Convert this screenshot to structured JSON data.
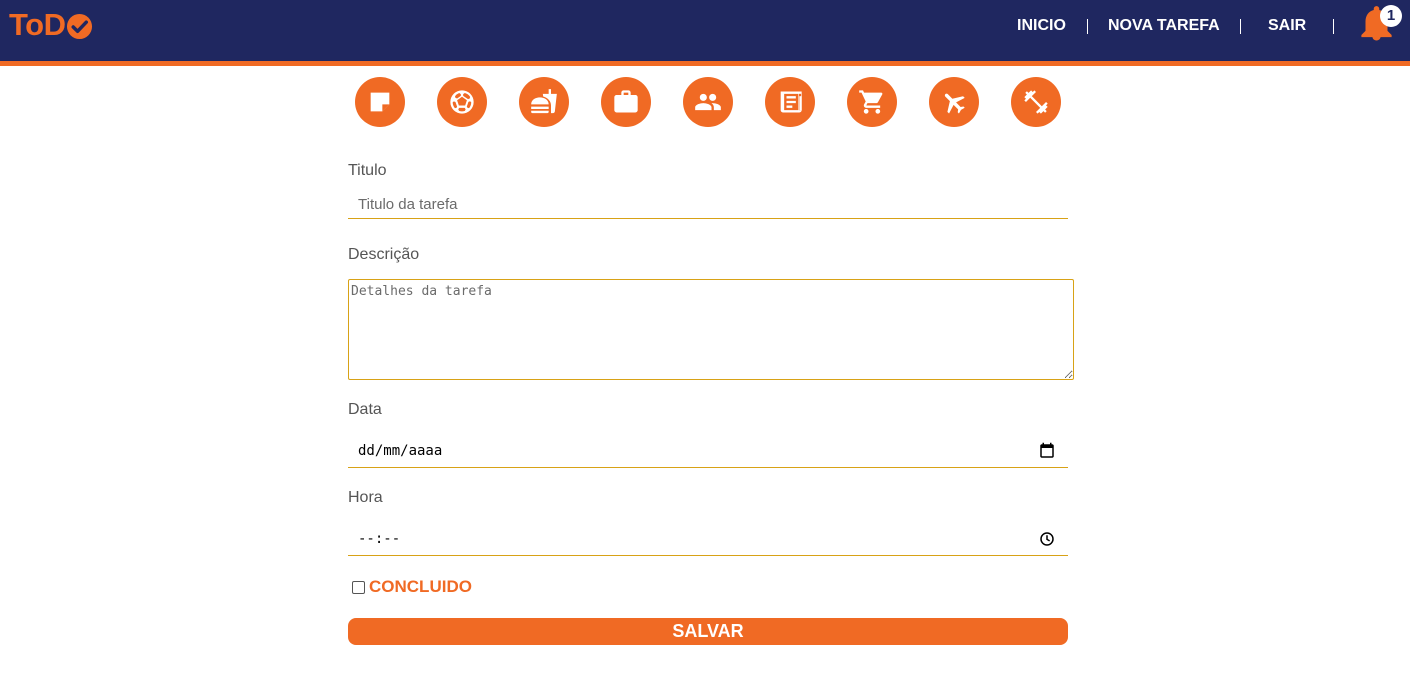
{
  "brand": {
    "logo_text": "ToD",
    "primary_color": "#1f2760",
    "accent_color": "#f06a24",
    "field_line_color": "#d8a216"
  },
  "nav": {
    "items": [
      {
        "label": "INICIO"
      },
      {
        "label": "NOVA TAREFA"
      },
      {
        "label": "SAIR"
      }
    ],
    "notifications": {
      "icon": "bell-icon",
      "count": "1"
    }
  },
  "categories": [
    {
      "name": "note",
      "icon": "sticky-note-icon"
    },
    {
      "name": "sports",
      "icon": "soccer-ball-icon"
    },
    {
      "name": "food",
      "icon": "fastfood-icon"
    },
    {
      "name": "work",
      "icon": "briefcase-icon"
    },
    {
      "name": "people",
      "icon": "people-icon"
    },
    {
      "name": "reading",
      "icon": "newspaper-icon"
    },
    {
      "name": "shopping",
      "icon": "shopping-cart-icon"
    },
    {
      "name": "travel",
      "icon": "airplane-icon"
    },
    {
      "name": "fitness",
      "icon": "dumbbell-icon"
    }
  ],
  "form": {
    "title": {
      "label": "Titulo",
      "placeholder": "Titulo da tarefa",
      "value": ""
    },
    "description": {
      "label": "Descrição",
      "placeholder": "Detalhes da tarefa",
      "value": ""
    },
    "date": {
      "label": "Data",
      "display": "dd/mm/aaaa",
      "icon": "calendar-icon"
    },
    "time": {
      "label": "Hora",
      "display": "--:--",
      "icon": "clock-icon"
    },
    "completed": {
      "label": "CONCLUIDO",
      "checked": false
    },
    "submit_label": "SALVAR"
  }
}
